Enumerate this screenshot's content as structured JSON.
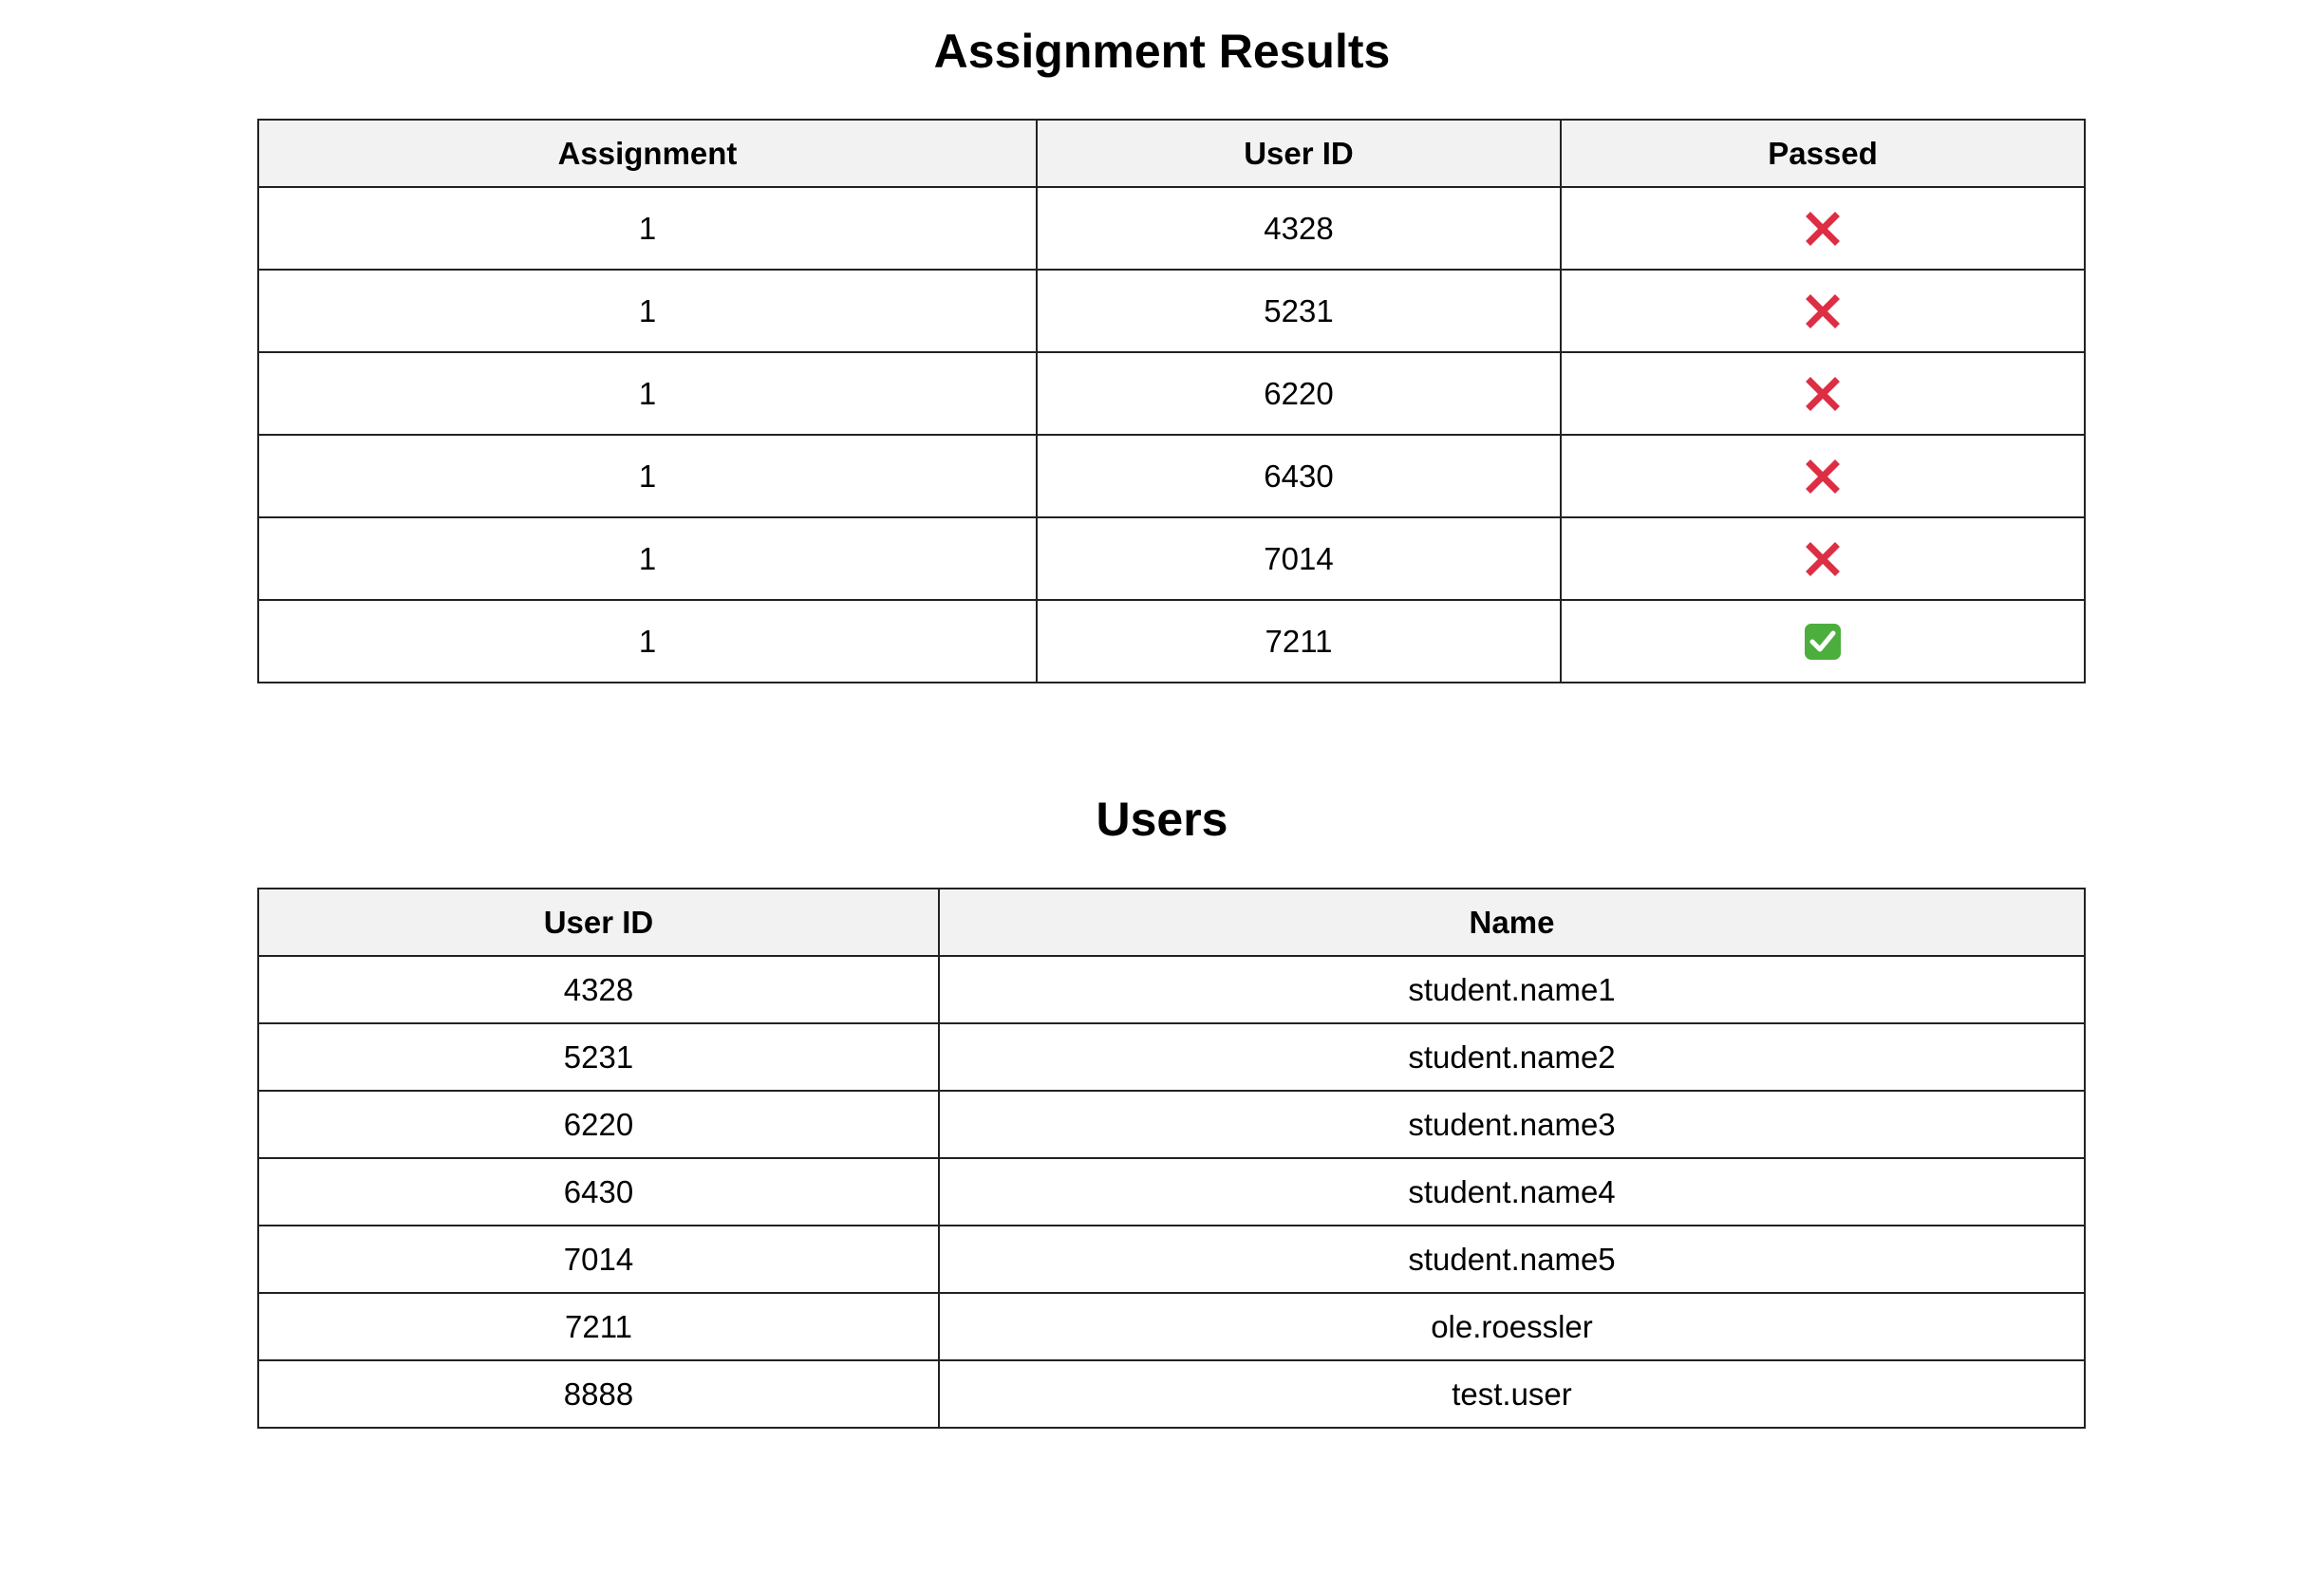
{
  "results": {
    "title": "Assignment Results",
    "columns": [
      "Assignment",
      "User ID",
      "Passed"
    ],
    "rows": [
      {
        "assignment": "1",
        "user_id": "4328",
        "passed": false,
        "icon": "cross-mark-icon"
      },
      {
        "assignment": "1",
        "user_id": "5231",
        "passed": false,
        "icon": "cross-mark-icon"
      },
      {
        "assignment": "1",
        "user_id": "6220",
        "passed": false,
        "icon": "cross-mark-icon"
      },
      {
        "assignment": "1",
        "user_id": "6430",
        "passed": false,
        "icon": "cross-mark-icon"
      },
      {
        "assignment": "1",
        "user_id": "7014",
        "passed": false,
        "icon": "cross-mark-icon"
      },
      {
        "assignment": "1",
        "user_id": "7211",
        "passed": true,
        "icon": "check-mark-button-icon"
      }
    ]
  },
  "users": {
    "title": "Users",
    "columns": [
      "User ID",
      "Name"
    ],
    "rows": [
      {
        "user_id": "4328",
        "name": "student.name1"
      },
      {
        "user_id": "5231",
        "name": "student.name2"
      },
      {
        "user_id": "6220",
        "name": "student.name3"
      },
      {
        "user_id": "6430",
        "name": "student.name4"
      },
      {
        "user_id": "7014",
        "name": "student.name5"
      },
      {
        "user_id": "7211",
        "name": "ole.roessler"
      },
      {
        "user_id": "8888",
        "name": "test.user"
      }
    ]
  },
  "colors": {
    "fail": "#dd2e44",
    "pass": "#4cae3d",
    "header_bg": "#f2f2f2",
    "border": "#222222"
  }
}
